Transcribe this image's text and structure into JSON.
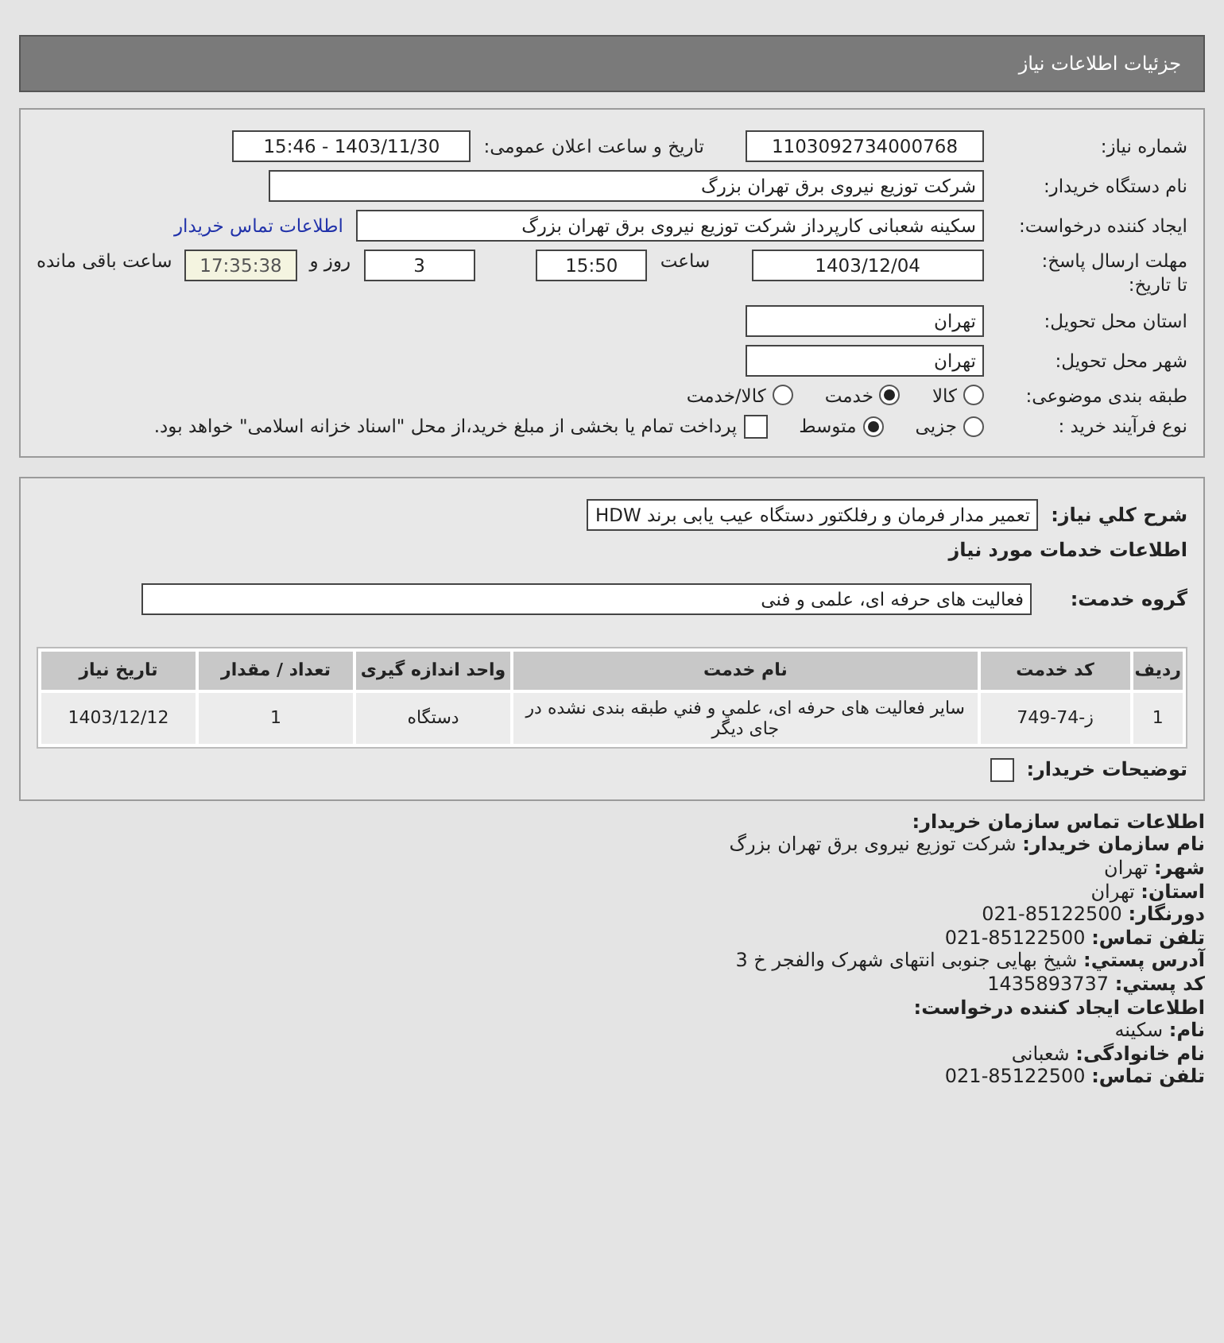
{
  "header": {
    "title": "جزئیات اطلاعات نیاز"
  },
  "need_number": {
    "label": "شماره نیاز:",
    "value": "1103092734000768"
  },
  "announce": {
    "label": "تاریخ و ساعت اعلان عمومی:",
    "value": "1403/11/30 - 15:46"
  },
  "buyer_org": {
    "label": "نام دستگاه خریدار:",
    "value": "شرکت توزیع نیروی برق تهران بزرگ"
  },
  "requester": {
    "label": "ایجاد کننده درخواست:",
    "value": "سکینه شعبانی کارپرداز شرکت توزیع نیروی برق تهران بزرگ",
    "link": "اطلاعات تماس خریدار"
  },
  "deadline": {
    "label": "مهلت ارسال پاسخ: تا تاریخ:",
    "date": "1403/12/04",
    "time_label": "ساعت",
    "time": "15:50",
    "days": "3",
    "days_label": "روز و",
    "remaining": "17:35:38",
    "remaining_label": "ساعت باقی مانده"
  },
  "province": {
    "label": "استان محل تحویل:",
    "value": "تهران"
  },
  "city": {
    "label": "شهر محل تحویل:",
    "value": "تهران"
  },
  "category": {
    "label": "طبقه بندی موضوعی:",
    "options": [
      {
        "label": "کالا",
        "selected": false
      },
      {
        "label": "خدمت",
        "selected": true
      },
      {
        "label": "کالا/خدمت",
        "selected": false
      }
    ]
  },
  "process": {
    "label": "نوع فرآیند خرید :",
    "options": [
      {
        "label": "جزیی",
        "selected": false
      },
      {
        "label": "متوسط",
        "selected": true
      }
    ],
    "payment": {
      "label": "پرداخت تمام یا بخشی از مبلغ خرید،از محل \"اسناد خزانه اسلامی\" خواهد بود.",
      "checked": false
    }
  },
  "summary": {
    "label": "شرح کلي نياز:",
    "value": "تعمیر مدار فرمان و رفلکتور دستگاه عیب یابی برند HDW"
  },
  "services_heading": "اطلاعات خدمات مورد نیاز",
  "service_group": {
    "label": "گروه خدمت:",
    "value": "فعالیت های حرفه ای، علمی و فنی"
  },
  "table": {
    "columns": [
      "ردیف",
      "کد خدمت",
      "نام خدمت",
      "واحد اندازه گیری",
      "تعداد / مقدار",
      "تاریخ نیاز"
    ],
    "rows": [
      [
        "1",
        "ز-74-749",
        "سایر فعالیت های حرفه ای، علمي و فني طبقه بندی نشده در جای دیگر",
        "دستگاه",
        "1",
        "1403/12/12"
      ]
    ]
  },
  "buyer_notes": {
    "label": "توضیحات خریدار:",
    "checked": false
  },
  "contact": [
    {
      "kind": "heading",
      "text": "اطلاعات تماس سازمان خریدار:"
    },
    {
      "kind": "field",
      "label": "نام سازمان خریدار:",
      "value": "شرکت توزیع نیروی برق تهران بزرگ"
    },
    {
      "kind": "field",
      "label": "شهر:",
      "value": "تهران"
    },
    {
      "kind": "field",
      "label": "استان:",
      "value": "تهران"
    },
    {
      "kind": "field",
      "label": "دورنگار:",
      "value": "85122500-021"
    },
    {
      "kind": "field",
      "label": "تلفن تماس:",
      "value": "85122500-021"
    },
    {
      "kind": "field",
      "label": "آدرس پستي:",
      "value": "شیخ بهایی جنوبی انتهای شهرک والفجر خ 3"
    },
    {
      "kind": "field",
      "label": "کد پستي:",
      "value": "1435893737"
    },
    {
      "kind": "heading",
      "text": "اطلاعات ایجاد کننده درخواست:"
    },
    {
      "kind": "field",
      "label": "نام:",
      "value": "سکینه"
    },
    {
      "kind": "field",
      "label": "نام خانوادگی:",
      "value": "شعبانی"
    },
    {
      "kind": "field",
      "label": "تلفن تماس:",
      "value": "85122500-021"
    }
  ]
}
